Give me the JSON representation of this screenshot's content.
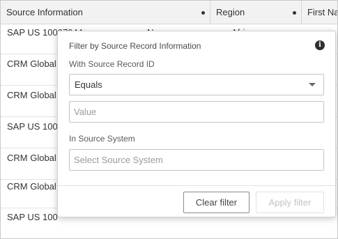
{
  "grid": {
    "columns": [
      {
        "label": "Source Information"
      },
      {
        "label": "Region"
      },
      {
        "label": "First Na"
      }
    ],
    "rows": [
      {
        "source": "SAP US 10007944",
        "region_partial": "N",
        "col3_partial": "Afri"
      },
      {
        "source": "CRM Global",
        "region_partial": "",
        "col3_partial": ""
      },
      {
        "source": "CRM Global",
        "region_partial": "",
        "col3_partial": ""
      },
      {
        "source": "SAP US 100",
        "region_partial": "",
        "col3_partial": ""
      },
      {
        "source": "CRM Global",
        "region_partial": "",
        "col3_partial": ""
      },
      {
        "source": "CRM Global",
        "region_partial": "",
        "col3_partial": ""
      },
      {
        "source": "SAP US 100",
        "region_partial": "",
        "col3_partial": ""
      }
    ]
  },
  "filter_popup": {
    "title": "Filter by Source Record Information",
    "info_icon": "info-icon",
    "record_id_label": "With Source Record ID",
    "operator_value": "Equals",
    "value_placeholder": "Value",
    "source_system_label": "In Source System",
    "source_system_placeholder": "Select Source System",
    "clear_label": "Clear filter",
    "apply_label": "Apply filter"
  }
}
